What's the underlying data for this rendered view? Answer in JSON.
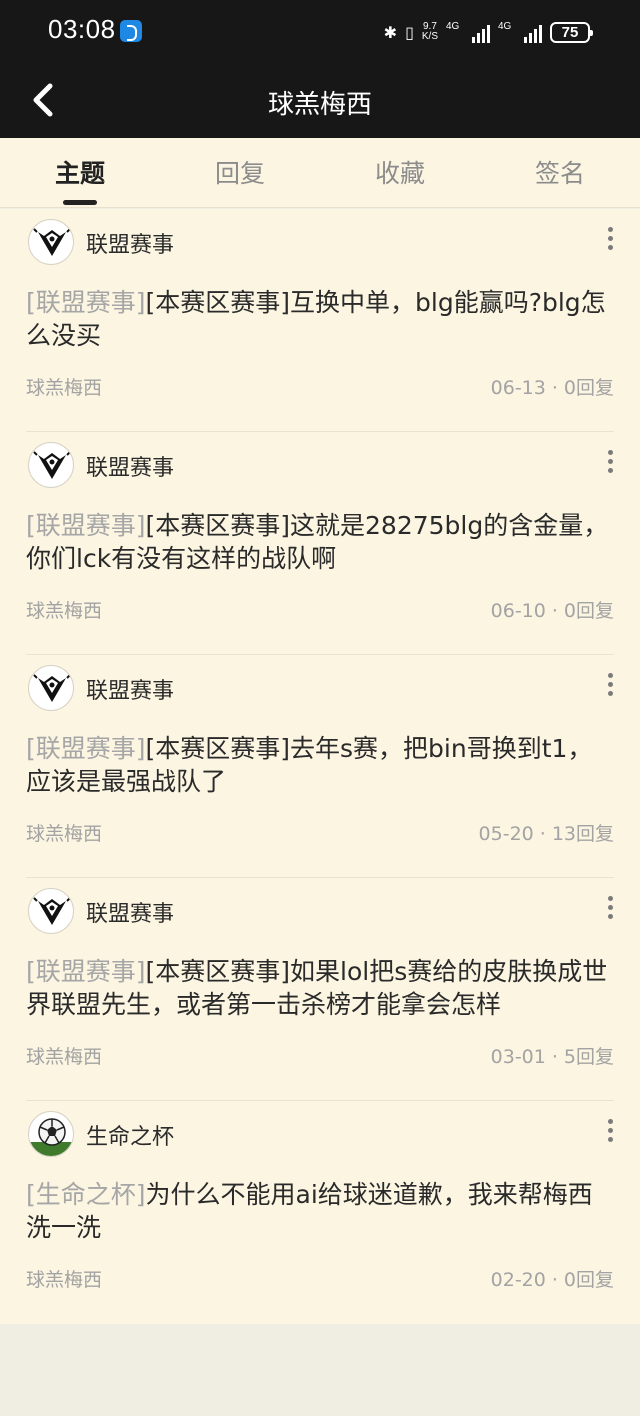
{
  "status_bar": {
    "time": "03:08",
    "net_speed_top": "9.7",
    "net_speed_bottom": "K/S",
    "signal1_label": "4G",
    "signal2_label": "4G",
    "battery": "75"
  },
  "header": {
    "title": "球羔梅西"
  },
  "tabs": [
    {
      "label": "主题",
      "active": true
    },
    {
      "label": "回复",
      "active": false
    },
    {
      "label": "收藏",
      "active": false
    },
    {
      "label": "签名",
      "active": false
    }
  ],
  "posts": [
    {
      "forum": "联盟赛事",
      "tag": "[联盟赛事]",
      "title": "[本赛区赛事]互换中单，blg能赢吗?blg怎么没买",
      "author": "球羔梅西",
      "date": "06-13",
      "replies": "0回复"
    },
    {
      "forum": "联盟赛事",
      "tag": "[联盟赛事]",
      "title": "[本赛区赛事]这就是28275blg的含金量，你们lck有没有这样的战队啊",
      "author": "球羔梅西",
      "date": "06-10",
      "replies": "0回复"
    },
    {
      "forum": "联盟赛事",
      "tag": "[联盟赛事]",
      "title": "[本赛区赛事]去年s赛，把bin哥换到t1，应该是最强战队了",
      "author": "球羔梅西",
      "date": "05-20",
      "replies": "13回复"
    },
    {
      "forum": "联盟赛事",
      "tag": "[联盟赛事]",
      "title": "[本赛区赛事]如果lol把s赛给的皮肤换成世界联盟先生，或者第一击杀榜才能拿会怎样",
      "author": "球羔梅西",
      "date": "03-01",
      "replies": "5回复"
    },
    {
      "forum": "生命之杯",
      "tag": "[生命之杯]",
      "title": "为什么不能用ai给球迷道歉，我来帮梅西洗一洗",
      "author": "球羔梅西",
      "date": "02-20",
      "replies": "0回复"
    }
  ],
  "meta_separator": "·"
}
